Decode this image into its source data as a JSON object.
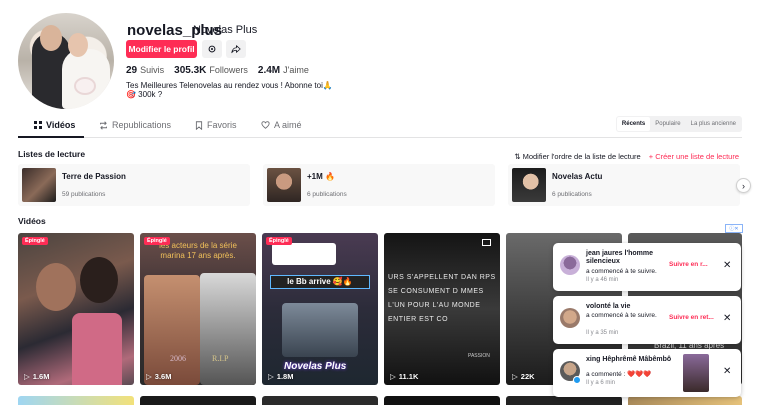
{
  "profile": {
    "username": "novelas_plus",
    "display_name": "Novelas Plus",
    "edit_button": "Modifier le profil",
    "following_count": "29",
    "following_label": "Suivis",
    "followers_count": "305.3K",
    "followers_label": "Followers",
    "likes_count": "2.4M",
    "likes_label": "J'aime",
    "bio_line1": "Tes Meilleures Telenovelas au rendez vous ! Abonne toi🙏",
    "bio_line2": "🎯 300k ?"
  },
  "tabs": [
    {
      "label": "Vidéos",
      "icon": "grid-icon"
    },
    {
      "label": "Republications",
      "icon": "repost-icon"
    },
    {
      "label": "Favoris",
      "icon": "bookmark-icon"
    },
    {
      "label": "A aimé",
      "icon": "heart-icon"
    }
  ],
  "sort": [
    "Récents",
    "Populaire",
    "La plus ancienne"
  ],
  "playlists_section": {
    "title": "Listes de lecture",
    "reorder": "⇅ Modifier l'ordre de la liste de lecture",
    "create": "+ Créer une liste de lecture",
    "items": [
      {
        "name": "Terre de Passion",
        "count": "59 publications"
      },
      {
        "name": "+1M 🔥",
        "count": "6 publications"
      },
      {
        "name": "Novelas Actu",
        "count": "6 publications"
      }
    ]
  },
  "videos_section": {
    "title": "Vidéos",
    "pinned_label": "Épinglé",
    "items": [
      {
        "views": "1.6M",
        "pinned": true,
        "overlay": ""
      },
      {
        "views": "3.6M",
        "pinned": true,
        "overlay": "les acteurs de la série marina 17 ans après."
      },
      {
        "views": "1.8M",
        "pinned": true,
        "overlay": "le Bb arrive 🥰🔥"
      },
      {
        "views": "11.1K",
        "pinned": false,
        "overlay": "URS S'APPELLENT DAN RPS SE CONSUMENT D MMES L'UN POUR L'AU MONDE ENTIER EST CO"
      },
      {
        "views": "22K",
        "pinned": false,
        "overlay": ""
      },
      {
        "views": "",
        "pinned": false,
        "overlay": "Brazil, 11 ans après"
      }
    ],
    "extra_texts": {
      "novelas_plus": "Novelas Plus",
      "passion": "PASSION",
      "rip": "R.I.P",
      "year": "2006"
    }
  },
  "ad_badge": "ⓘ✕",
  "notifications": [
    {
      "name": "jean jaures l'homme silencieux",
      "action": "a commencé à te suivre.",
      "time": "Il y a 46 min",
      "button": "Suivre en r..."
    },
    {
      "name": "volonté la vie",
      "action": "a commencé à te suivre.",
      "time": "Il y a 35 min",
      "button": "Suivre en ret..."
    },
    {
      "name": "xing Hêphrêmê Mâbêmbô",
      "action": "a commenté : ❤️❤️❤️",
      "time": "Il y a 6 min",
      "button": ""
    }
  ],
  "colors": {
    "accent": "#fe2c55",
    "text": "#161823",
    "muted": "#6d6e73"
  }
}
